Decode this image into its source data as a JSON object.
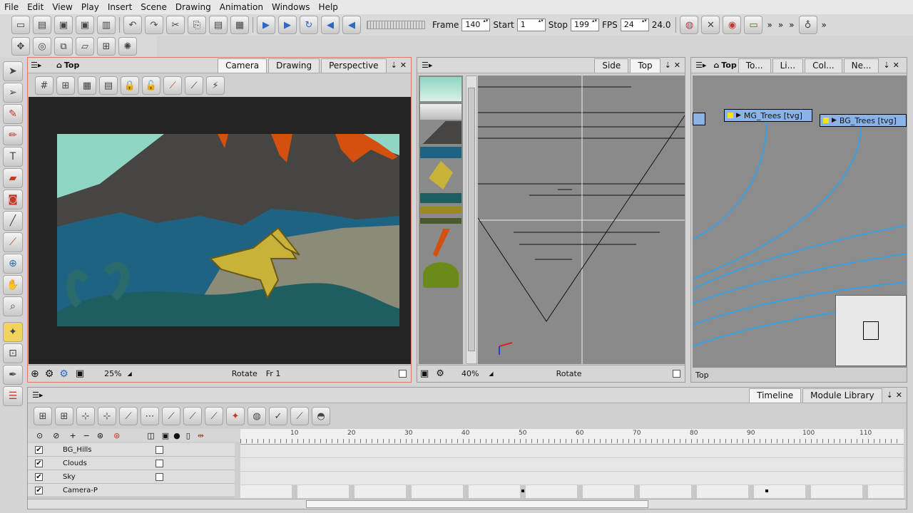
{
  "menu": [
    "File",
    "Edit",
    "View",
    "Play",
    "Insert",
    "Scene",
    "Drawing",
    "Animation",
    "Windows",
    "Help"
  ],
  "playback": {
    "frame_label": "Frame",
    "frame": "140",
    "start_label": "Start",
    "start": "1",
    "stop_label": "Stop",
    "stop": "199",
    "fps_label": "FPS",
    "fps": "24",
    "fps_readout": "24.0"
  },
  "camera_view": {
    "title": "Top",
    "tabs": [
      "Camera",
      "Drawing",
      "Perspective"
    ],
    "zoom": "25%",
    "mode": "Rotate",
    "frame": "Fr 1"
  },
  "side_view": {
    "tabs": [
      "Side",
      "Top"
    ],
    "zoom": "40%",
    "mode": "Rotate"
  },
  "node_view": {
    "title": "Top",
    "tabs": [
      "To...",
      "Li...",
      "Col...",
      "Ne..."
    ],
    "nodes": [
      "MG_Trees  [tvg]",
      "BG_Trees  [tvg]"
    ],
    "footer": "Top"
  },
  "timeline": {
    "tabs": [
      "Timeline",
      "Module Library"
    ],
    "ticks": [
      "10",
      "20",
      "30",
      "40",
      "50",
      "60",
      "70",
      "80",
      "90",
      "100",
      "110"
    ],
    "layers": [
      {
        "name": "BG_Hills",
        "checked": "✔"
      },
      {
        "name": "Clouds",
        "checked": "✔"
      },
      {
        "name": "Sky",
        "checked": "✔"
      },
      {
        "name": "Camera-P",
        "checked": "✔"
      }
    ]
  },
  "colors": {
    "accent": "#e05a3a",
    "sky": "#8fd6c4",
    "node_line": "#3aa0e0"
  }
}
